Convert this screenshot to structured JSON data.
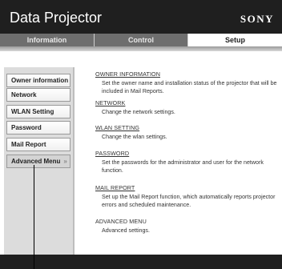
{
  "header": {
    "title": "Data Projector",
    "brand": "SONY"
  },
  "tabs": [
    {
      "label": "Information"
    },
    {
      "label": "Control"
    },
    {
      "label": "Setup"
    }
  ],
  "sidebar": {
    "items": [
      {
        "label": "Owner information"
      },
      {
        "label": "Network"
      },
      {
        "label": "WLAN Setting"
      },
      {
        "label": "Password"
      },
      {
        "label": "Mail Report"
      },
      {
        "label": "Advanced Menu",
        "chevron": "»"
      }
    ]
  },
  "main": {
    "items": [
      {
        "title": "OWNER INFORMATION",
        "desc": "Set the owner name and installation status of the projector that will be included in Mail Reports."
      },
      {
        "title": "NETWORK",
        "desc": "Change the network settings."
      },
      {
        "title": "WLAN SETTING",
        "desc": "Change the wlan settings."
      },
      {
        "title": "PASSWORD",
        "desc": "Set the passwords for the administrator and user for the network function."
      },
      {
        "title": "MAIL REPORT",
        "desc": "Set up the Mail Report function, which automatically reports projector errors and scheduled maintenance."
      },
      {
        "title": "ADVANCED MENU",
        "desc": "Advanced settings."
      }
    ]
  },
  "colors": {
    "header_bg": "#1f1f1f",
    "tab_bg": "#6e6e6e",
    "active_tab_bg": "#ffffff",
    "sidebar_bg": "#dcdcdc"
  },
  "icons": {
    "advanced_chevron": "double-chevron-icon"
  }
}
